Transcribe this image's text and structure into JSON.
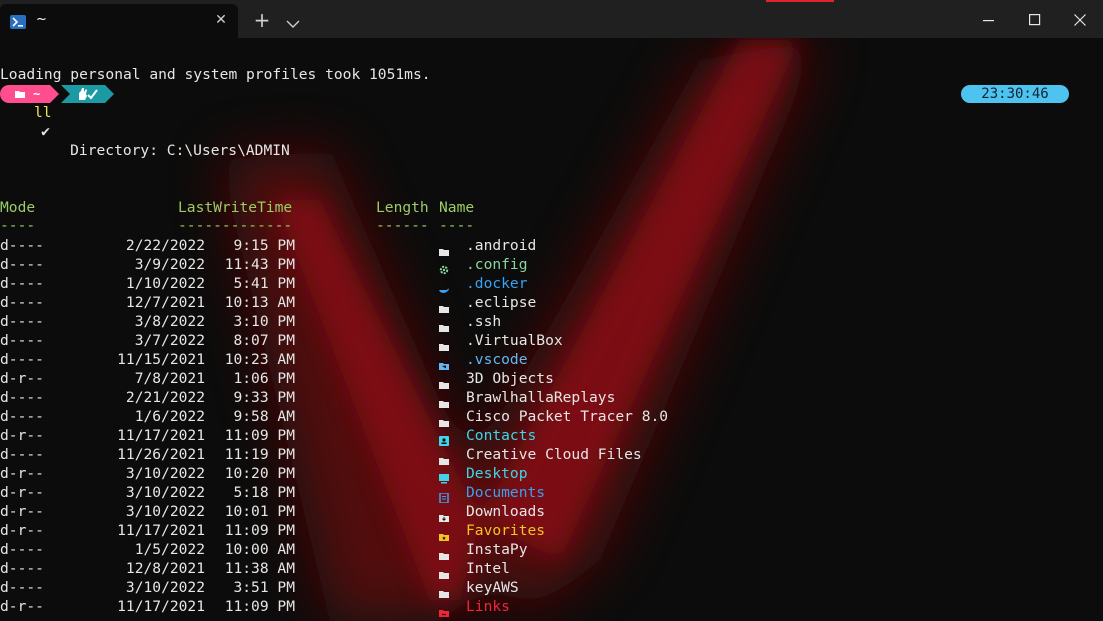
{
  "window": {
    "tab_title": "~",
    "tab_icon": "powershell-icon",
    "new_tab_label": "+",
    "close_tab_label": "✕"
  },
  "terminal": {
    "loading_message": "Loading personal and system profiles took 1051ms.",
    "prompt": {
      "path": "~",
      "time": "23:30:46",
      "check": "✔",
      "command": "ll"
    },
    "directory_label": "    Directory: C:\\Users\\ADMIN",
    "headers": {
      "mode": "Mode",
      "lastwritetime": "LastWriteTime",
      "length": "Length",
      "name": "Name",
      "mode_ul": "----",
      "lastwritetime_ul": "-------------",
      "length_ul": "------",
      "name_ul": "----"
    },
    "entries": [
      {
        "mode": "d----",
        "date": "2/22/2022",
        "time": "9:15 PM",
        "name": ".android",
        "icon": "folder-icon",
        "color": "#e6e6e6"
      },
      {
        "mode": "d----",
        "date": "3/9/2022",
        "time": "11:43 PM",
        "name": ".config",
        "icon": "gear-icon",
        "color": "#8bd49c"
      },
      {
        "mode": "d----",
        "date": "1/10/2022",
        "time": "5:41 PM",
        "name": ".docker",
        "icon": "docker-icon",
        "color": "#3aa0f0"
      },
      {
        "mode": "d----",
        "date": "12/7/2021",
        "time": "10:13 AM",
        "name": ".eclipse",
        "icon": "folder-icon",
        "color": "#e6e6e6"
      },
      {
        "mode": "d----",
        "date": "3/8/2022",
        "time": "3:10 PM",
        "name": ".ssh",
        "icon": "folder-icon",
        "color": "#e6e6e6"
      },
      {
        "mode": "d----",
        "date": "3/7/2022",
        "time": "8:07 PM",
        "name": ".VirtualBox",
        "icon": "folder-icon",
        "color": "#e6e6e6"
      },
      {
        "mode": "d----",
        "date": "11/15/2021",
        "time": "10:23 AM",
        "name": ".vscode",
        "icon": "vscode-folder-icon",
        "color": "#66b6f2"
      },
      {
        "mode": "d-r--",
        "date": "7/8/2021",
        "time": "1:06 PM",
        "name": "3D Objects",
        "icon": "folder-icon",
        "color": "#e6e6e6"
      },
      {
        "mode": "d----",
        "date": "2/21/2022",
        "time": "9:33 PM",
        "name": "BrawlhallaReplays",
        "icon": "folder-icon",
        "color": "#e6e6e6"
      },
      {
        "mode": "d----",
        "date": "1/6/2022",
        "time": "9:58 AM",
        "name": "Cisco Packet Tracer 8.0",
        "icon": "folder-icon",
        "color": "#e6e6e6"
      },
      {
        "mode": "d-r--",
        "date": "11/17/2021",
        "time": "11:09 PM",
        "name": "Contacts",
        "icon": "contacts-icon",
        "color": "#3ed6e8"
      },
      {
        "mode": "d----",
        "date": "11/26/2021",
        "time": "11:19 PM",
        "name": "Creative Cloud Files",
        "icon": "folder-icon",
        "color": "#e6e6e6"
      },
      {
        "mode": "d-r--",
        "date": "3/10/2022",
        "time": "10:20 PM",
        "name": "Desktop",
        "icon": "desktop-icon",
        "color": "#3ed6e8"
      },
      {
        "mode": "d-r--",
        "date": "3/10/2022",
        "time": "5:18 PM",
        "name": "Documents",
        "icon": "documents-icon",
        "color": "#3aa0f0"
      },
      {
        "mode": "d-r--",
        "date": "3/10/2022",
        "time": "10:01 PM",
        "name": "Downloads",
        "icon": "downloads-icon",
        "color": "#e6e6e6"
      },
      {
        "mode": "d-r--",
        "date": "11/17/2021",
        "time": "11:09 PM",
        "name": "Favorites",
        "icon": "favorites-icon",
        "color": "#f5c320"
      },
      {
        "mode": "d----",
        "date": "1/5/2022",
        "time": "10:00 AM",
        "name": "InstaPy",
        "icon": "folder-icon",
        "color": "#e6e6e6"
      },
      {
        "mode": "d----",
        "date": "12/8/2021",
        "time": "11:38 AM",
        "name": "Intel",
        "icon": "folder-icon",
        "color": "#e6e6e6"
      },
      {
        "mode": "d----",
        "date": "3/10/2022",
        "time": "3:51 PM",
        "name": "keyAWS",
        "icon": "folder-icon",
        "color": "#e6e6e6"
      },
      {
        "mode": "d-r--",
        "date": "11/17/2021",
        "time": "11:09 PM",
        "name": "Links",
        "icon": "links-icon",
        "color": "#f0243a"
      }
    ]
  },
  "colors": {
    "prompt_pink": "#ff4d8d",
    "prompt_teal": "#1b9aa3",
    "clock_bg": "#4fc3ef",
    "header_green": "#9ccc65",
    "command_yellow": "#f2e25c"
  }
}
